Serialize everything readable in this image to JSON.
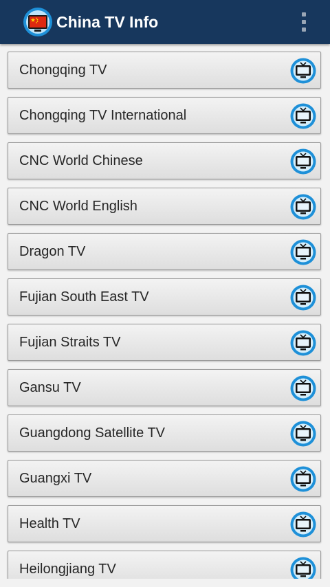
{
  "app": {
    "title": "China TV Info",
    "icon": "tv-with-china-flag-icon",
    "menu_icon": "overflow-menu-icon"
  },
  "colors": {
    "appbar": "#17375d",
    "item_background": "#e6e6e6",
    "tv_icon_ring": "#1e90d8",
    "flag_red": "#de2910",
    "flag_star": "#ffde00"
  },
  "channels": [
    {
      "name": "Chongqing TV",
      "icon": "tv-icon"
    },
    {
      "name": "Chongqing TV International",
      "icon": "tv-icon"
    },
    {
      "name": "CNC World Chinese",
      "icon": "tv-icon"
    },
    {
      "name": "CNC World English",
      "icon": "tv-icon"
    },
    {
      "name": "Dragon TV",
      "icon": "tv-icon"
    },
    {
      "name": "Fujian South East TV",
      "icon": "tv-icon"
    },
    {
      "name": "Fujian Straits TV",
      "icon": "tv-icon"
    },
    {
      "name": "Gansu TV",
      "icon": "tv-icon"
    },
    {
      "name": "Guangdong Satellite TV",
      "icon": "tv-icon"
    },
    {
      "name": "Guangxi TV",
      "icon": "tv-icon"
    },
    {
      "name": "Health TV",
      "icon": "tv-icon"
    },
    {
      "name": "Heilongjiang TV",
      "icon": "tv-icon"
    }
  ]
}
